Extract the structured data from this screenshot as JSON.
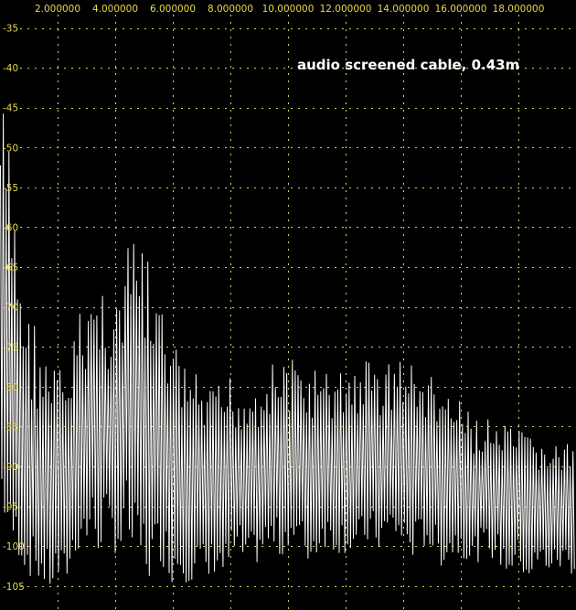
{
  "chart_data": {
    "type": "line",
    "title": "audio screened cable, 0.43m",
    "x_tick_labels": [
      "2.000000",
      "4.000000",
      "6.000000",
      "8.000000",
      "10.000000",
      "12.000000",
      "14.000000",
      "16.000000",
      "18.000000"
    ],
    "x_ticks": [
      2,
      4,
      6,
      8,
      10,
      12,
      14,
      16,
      18
    ],
    "xlim": [
      0,
      20
    ],
    "y_tick_labels": [
      "-35",
      "-40",
      "-45",
      "-50",
      "-55",
      "-60",
      "-65",
      "-70",
      "-75",
      "-80",
      "-85",
      "-90",
      "-95",
      "-100",
      "-105"
    ],
    "y_ticks": [
      -35,
      -40,
      -45,
      -50,
      -55,
      -60,
      -65,
      -70,
      -75,
      -80,
      -85,
      -90,
      -95,
      -100,
      -105
    ],
    "ylim": [
      -108,
      -31.5
    ],
    "grid": true,
    "colors": {
      "background": "#000000",
      "trace": "#ffffff",
      "grid": "#d8d060",
      "ticks": "#e8d84a",
      "title": "#ffffff"
    },
    "series": [
      {
        "x": [
          0.05,
          0.2,
          0.4,
          0.6,
          0.8,
          1.0,
          1.2,
          1.4,
          1.6,
          1.8,
          2.0,
          2.2,
          2.5,
          2.8,
          3.0,
          3.2,
          3.4,
          3.6,
          3.8,
          4.0,
          4.2,
          4.4,
          4.6,
          4.8,
          5.0,
          5.2,
          5.4,
          5.6,
          5.8,
          6.0,
          6.3,
          6.6,
          6.9,
          7.2,
          7.5,
          7.8,
          8.0,
          8.3,
          8.6,
          9.0,
          9.4,
          9.8,
          10.0,
          10.4,
          10.8,
          11.2,
          11.6,
          12.0,
          12.4,
          12.8,
          13.2,
          13.6,
          14.0,
          14.4,
          14.8,
          15.2,
          15.6,
          16.0,
          16.4,
          16.8,
          17.2,
          17.6,
          18.0,
          18.4,
          18.8,
          19.2,
          19.6,
          19.95
        ],
        "upper": [
          -42,
          -45,
          -52,
          -58,
          -66,
          -70,
          -71,
          -73,
          -76,
          -77,
          -76,
          -79,
          -74,
          -70,
          -68,
          -66,
          -69,
          -65,
          -70,
          -66,
          -69,
          -63,
          -61,
          -61,
          -62,
          -65,
          -68,
          -70,
          -71,
          -74,
          -76,
          -77,
          -79,
          -80,
          -80,
          -79,
          -78,
          -80,
          -79,
          -78,
          -77,
          -76,
          -76,
          -77,
          -77,
          -78,
          -78,
          -77,
          -77,
          -76,
          -77,
          -76,
          -76,
          -77,
          -78,
          -79,
          -80,
          -82,
          -83,
          -84,
          -84,
          -85,
          -85,
          -86,
          -86,
          -87,
          -87,
          -86
        ],
        "lower": [
          -95,
          -98,
          -100,
          -101,
          -103,
          -104,
          -104,
          -105,
          -106,
          -106,
          -105,
          -106,
          -103,
          -100,
          -101,
          -99,
          -102,
          -99,
          -100,
          -101,
          -102,
          -99,
          -103,
          -104,
          -104,
          -105,
          -103,
          -102,
          -104,
          -105,
          -104,
          -105,
          -104,
          -106,
          -103,
          -105,
          -103,
          -102,
          -104,
          -102,
          -101,
          -102,
          -100,
          -101,
          -103,
          -100,
          -101,
          -101,
          -102,
          -100,
          -101,
          -99,
          -101,
          -102,
          -100,
          -103,
          -102,
          -101,
          -103,
          -101,
          -102,
          -104,
          -103,
          -105,
          -103,
          -104,
          -103,
          -104
        ],
        "mid": [
          -80,
          -85,
          -88,
          -88,
          -90,
          -92,
          -92,
          -93,
          -93,
          -94,
          -92,
          -94,
          -91,
          -88,
          -86,
          -85,
          -87,
          -84,
          -87,
          -86,
          -87,
          -82,
          -83,
          -84,
          -85,
          -88,
          -88,
          -88,
          -89,
          -90,
          -91,
          -92,
          -92,
          -93,
          -92,
          -93,
          -91,
          -91,
          -92,
          -91,
          -90,
          -90,
          -89,
          -90,
          -91,
          -90,
          -90,
          -90,
          -90,
          -89,
          -90,
          -89,
          -89,
          -90,
          -90,
          -91,
          -92,
          -92,
          -93,
          -93,
          -93,
          -94,
          -94,
          -95,
          -95,
          -95,
          -95,
          -95
        ]
      }
    ]
  }
}
